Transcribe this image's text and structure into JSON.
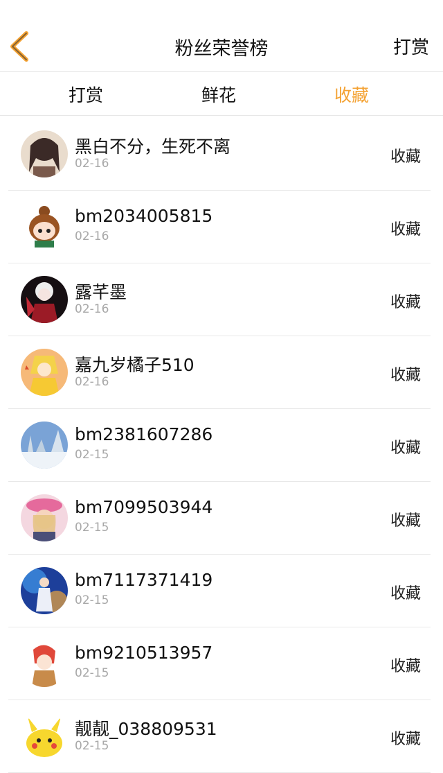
{
  "header": {
    "title": "粉丝荣誉榜",
    "action_label": "打赏"
  },
  "tabs": [
    {
      "label": "打赏"
    },
    {
      "label": "鲜花"
    },
    {
      "label": "收藏"
    }
  ],
  "active_tab": "收藏",
  "accent_color": "#f4a233",
  "fans": [
    {
      "name": "黑白不分，生死不离",
      "date": "02-16",
      "type": "收藏"
    },
    {
      "name": "bm2034005815",
      "date": "02-16",
      "type": "收藏"
    },
    {
      "name": "露芊墨",
      "date": "02-16",
      "type": "收藏"
    },
    {
      "name": "嘉九岁橘子510",
      "date": "02-16",
      "type": "收藏"
    },
    {
      "name": "bm2381607286",
      "date": "02-15",
      "type": "收藏"
    },
    {
      "name": "bm7099503944",
      "date": "02-15",
      "type": "收藏"
    },
    {
      "name": "bm7117371419",
      "date": "02-15",
      "type": "收藏"
    },
    {
      "name": "bm9210513957",
      "date": "02-15",
      "type": "收藏"
    },
    {
      "name": "靓靓_038809531",
      "date": "02-15",
      "type": "收藏"
    }
  ]
}
